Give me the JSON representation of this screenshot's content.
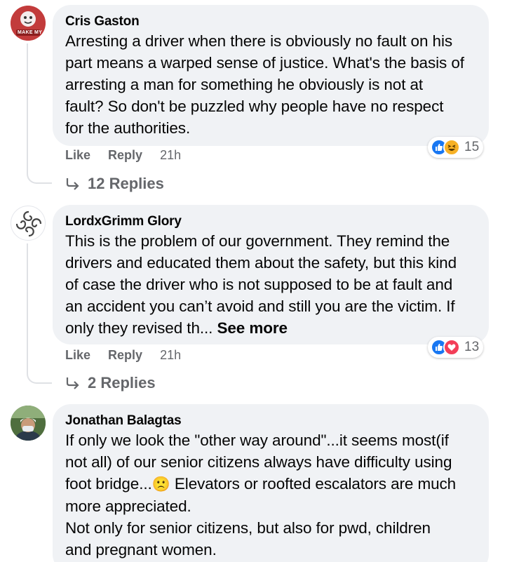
{
  "comments": [
    {
      "author": "Cris Gaston",
      "avatar_badge": "MAKE MY",
      "lines": [
        "Arresting a driver when there is obviously no fault on his",
        "part means a warped sense of justice. What's the basis of",
        "arresting a man for something he obviously is not at",
        "fault? So don't be puzzled why people have no respect",
        "for the authorities."
      ],
      "reactions": {
        "icons": [
          "like-icon",
          "haha-icon"
        ],
        "count": "15"
      },
      "like_label": "Like",
      "reply_label": "Reply",
      "time": "21h",
      "replies_label": "12 Replies"
    },
    {
      "author": "LordxGrimm Glory",
      "lines": [
        "This is the problem of our government. They remind the",
        "drivers and educated them about the safety, but this kind",
        "of case the driver who is not supposed to be at fault and",
        "an accident you can’t avoid and still you are the victim. If",
        "only they revised th..."
      ],
      "see_more": "See more",
      "reactions": {
        "icons": [
          "like-icon",
          "love-icon"
        ],
        "count": "13"
      },
      "like_label": "Like",
      "reply_label": "Reply",
      "time": "21h",
      "replies_label": "2 Replies"
    },
    {
      "author": "Jonathan Balagtas",
      "lines": [
        "If only we look the \"other way around\"...it seems most(if",
        "not all) of our senior citizens always have difficulty using",
        "foot bridge...",
        " Elevators or roofted escalators are much",
        "more appreciated.",
        "Not only for senior citizens, but also for pwd, children",
        "and pregnant women."
      ],
      "emoji": "🙁"
    }
  ],
  "colors": {
    "bubble_bg": "#f0f2f5",
    "meta_text": "#65676b",
    "like_blue": "#1877f2",
    "haha_yellow": "#f7b125",
    "love_red": "#f33e58"
  }
}
